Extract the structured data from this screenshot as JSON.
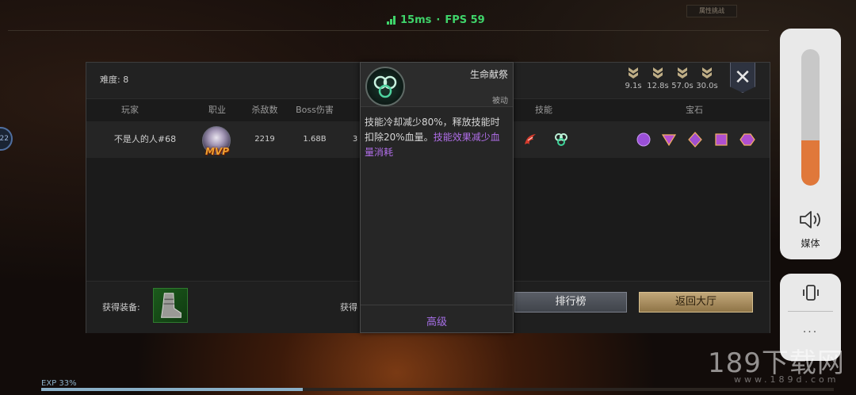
{
  "hud": {
    "latency": "15ms",
    "separator": "·",
    "fps": "FPS 59",
    "status_color": "#3fd46a",
    "top_right_tag": "属性挑战",
    "left_badge": "22"
  },
  "panel": {
    "difficulty": "难度: 8",
    "rank_timers": [
      "9.1s",
      "12.8s",
      "57.0s",
      "30.0s"
    ],
    "close_icon": "close-icon",
    "columns": [
      "玩家",
      "职业",
      "杀敌数",
      "Boss伤害",
      "技能",
      "宝石"
    ],
    "row": {
      "player": "不是人的人#68",
      "badge": "MVP",
      "kills": "2219",
      "boss_damage": "1.68B",
      "partial_cell": "3",
      "skill_icons": [
        "red-dragon-skill-icon",
        "green-clover-skill-icon"
      ],
      "gems": [
        "purple-orb-gem",
        "inverted-triangle-gem",
        "diamond-gem",
        "square-gem",
        "hexagon-gem"
      ]
    },
    "footer": {
      "equip_label": "获得装备:",
      "equip_label_2": "获得",
      "rank_button": "排行榜",
      "lobby_button": "返回大厅"
    }
  },
  "tooltip": {
    "name": "生命献祭",
    "type": "被动",
    "desc_main": "技能冷却减少80%，释放技能时扣除20%血量。",
    "desc_highlight": "技能效果减少血量消耗",
    "level": "高级",
    "highlight_color": "#b06ee8"
  },
  "side_controls": {
    "volume_level": 0.33,
    "volume_label": "媒体",
    "more": "...",
    "accent": "#e0783a"
  },
  "exp": {
    "label": "EXP 33%",
    "progress": 0.33
  },
  "watermark": {
    "main": "189下载网",
    "sub": "www.189d.com"
  }
}
